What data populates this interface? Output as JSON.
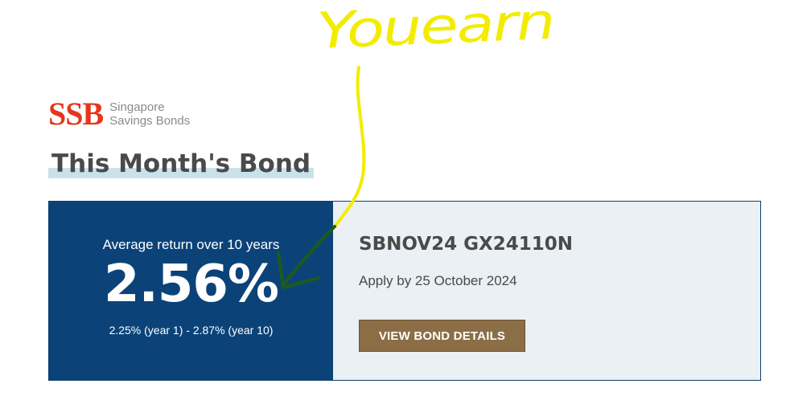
{
  "logo": {
    "mark": "SSB",
    "line1": "Singapore",
    "line2": "Savings Bonds"
  },
  "page": {
    "heading": "This Month's Bond"
  },
  "bond": {
    "average_label": "Average return over 10 years",
    "average_rate": "2.56%",
    "rate_range": "2.25% (year 1) - 2.87% (year 10)",
    "code": "SBNOV24 GX24110N",
    "apply_by": "Apply by 25 October 2024",
    "details_button": "VIEW BOND DETAILS"
  },
  "annotation": {
    "text": "Youearn",
    "colors": {
      "text": "#f2ec00",
      "arrow_head": "#1f5a1a"
    }
  },
  "colors": {
    "brand_red": "#e5361c",
    "panel_blue": "#0b4379",
    "panel_light": "#eaf0f3",
    "button_brown": "#8b6e46",
    "highlight": "#c9e2ea"
  }
}
